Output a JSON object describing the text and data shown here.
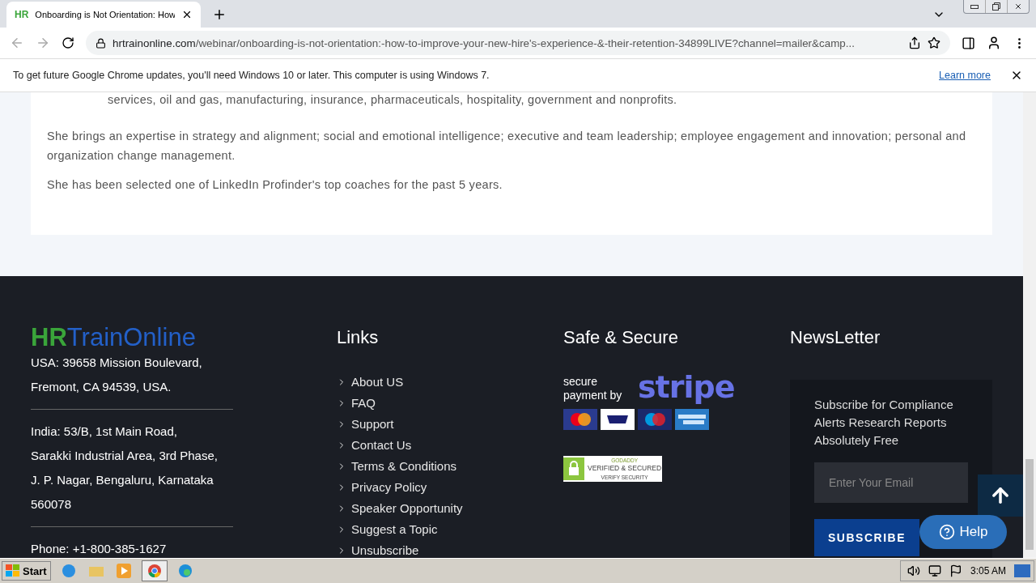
{
  "browser": {
    "tab": {
      "favicon": "HR",
      "title": "Onboarding is Not Orientation: How",
      "selected": true
    },
    "url_host": "hrtrainonline.com",
    "url_path": "/webinar/onboarding-is-not-orientation:-how-to-improve-your-new-hire's-experience-&-their-retention-34899LIVE?channel=mailer&camp...",
    "infobar": {
      "message": "To get future Google Chrome updates, you'll need Windows 10 or later. This computer is using Windows 7.",
      "link": "Learn more"
    }
  },
  "article": {
    "list_tail": "services, oil and gas, manufacturing, insurance, pharmaceuticals, hospitality, government and nonprofits.",
    "paragraphs": [
      "She brings an expertise in strategy and alignment; social and emotional intelligence; executive and team leadership; employee engagement and innovation; personal and organization change management.",
      "She has been selected one of LinkedIn Profinder's top coaches for the past 5 years."
    ]
  },
  "footer": {
    "logo": {
      "part1": "HR",
      "part2": "TrainOnline"
    },
    "addresses": [
      "USA: 39658 Mission Boulevard, Fremont, CA 94539, USA.",
      "India: 53/B, 1st Main Road, Sarakki Industrial Area, 3rd Phase, J. P. Nagar, Bengaluru, Karnataka 560078",
      "Phone: +1-800-385-1627"
    ],
    "links_title": "Links",
    "links": [
      "About US",
      "FAQ",
      "Support",
      "Contact Us",
      "Terms & Conditions",
      "Privacy Policy",
      "Speaker Opportunity",
      "Suggest a Topic",
      "Unsubscribe"
    ],
    "secure_title": "Safe & Secure",
    "stripe_caption": "secure payment by",
    "stripe_word": "stripe",
    "seal": {
      "brand": "GODADDY",
      "line1": "VERIFIED & SECURED",
      "line2": "VERIFY SECURITY"
    },
    "newsletter_title": "NewsLetter",
    "newsletter_text": "Subscribe for Compliance Alerts Research Reports Absolutely Free",
    "email_placeholder": "Enter Your Email",
    "subscribe": "SUBSCRIBE",
    "help": "Help"
  },
  "taskbar": {
    "start": "Start",
    "clock": "3:05 AM"
  }
}
